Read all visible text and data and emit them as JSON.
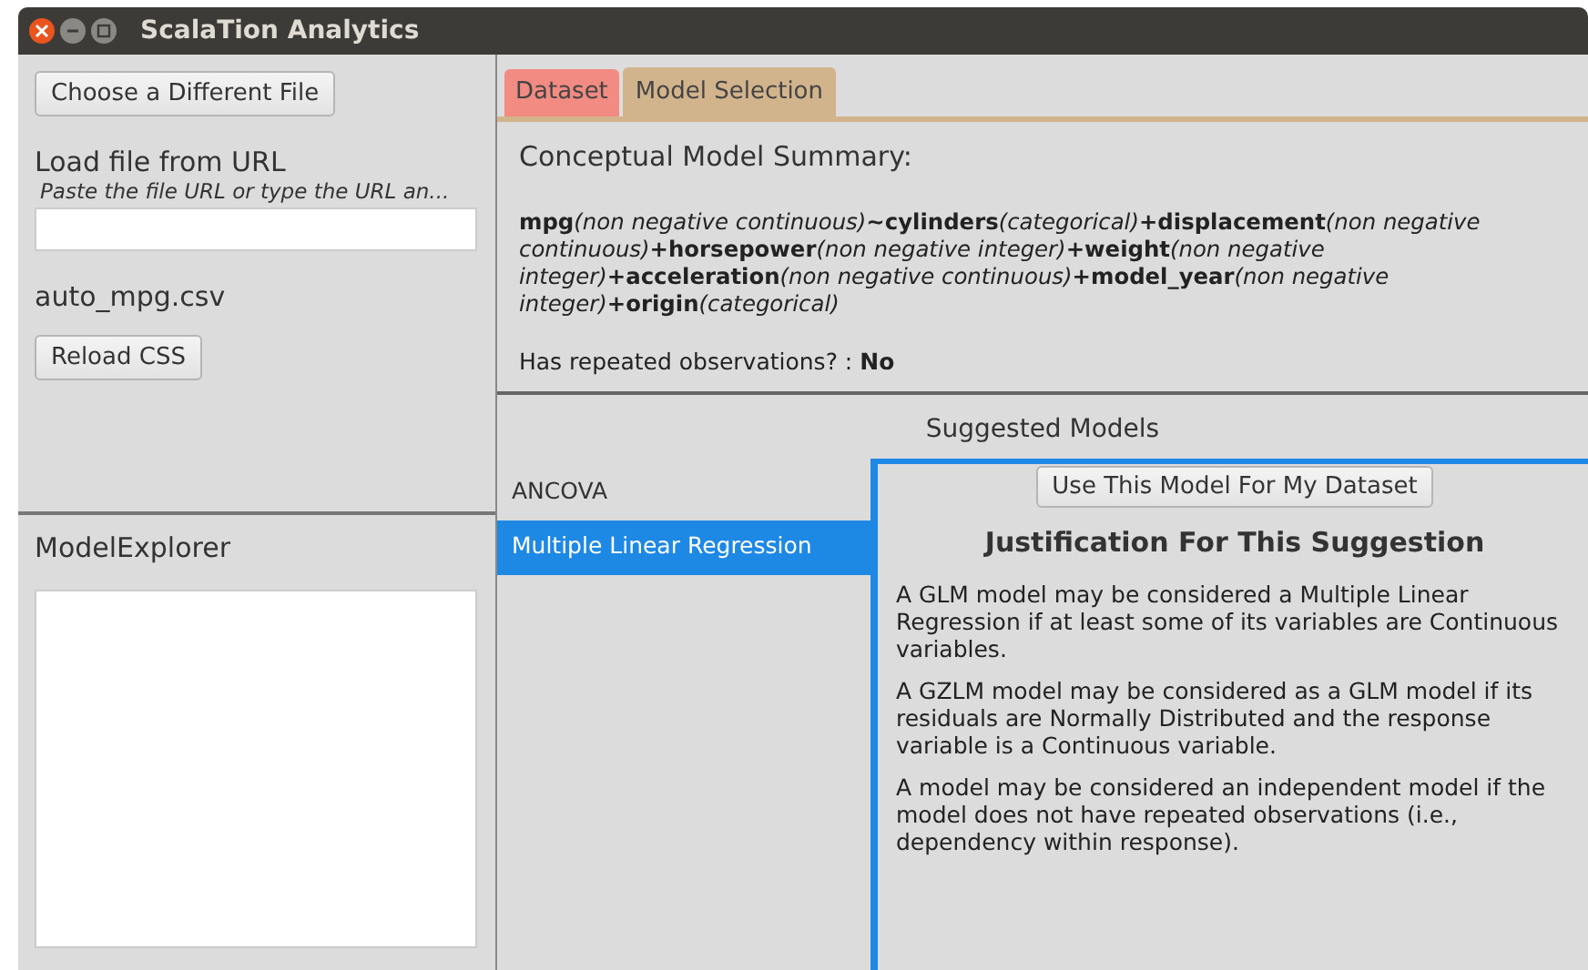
{
  "window": {
    "title": "ScalaTion Analytics"
  },
  "left_panel": {
    "choose_button": "Choose a Different File",
    "url_label": "Load file from URL",
    "url_placeholder": "Paste the file URL or type the URL an...",
    "file_name": "auto_mpg.csv",
    "reload_button": "Reload CSS"
  },
  "explorer": {
    "title": "ModelExplorer"
  },
  "tabs": [
    {
      "label": "Dataset",
      "selected": false,
      "color": "#f28b82"
    },
    {
      "label": "Model Selection",
      "selected": true,
      "color": "#d2b48c"
    }
  ],
  "summary": {
    "title": "Conceptual Model Summary:",
    "terms": [
      {
        "variable": "mpg",
        "type": "(non negative continuous)"
      },
      {
        "operator": "~",
        "variable": "cylinders",
        "type": "(categorical)"
      },
      {
        "operator": "+",
        "variable": "displacement",
        "type": "(non negative continuous)"
      },
      {
        "operator": "+",
        "variable": "horsepower",
        "type": "(non negative integer)"
      },
      {
        "operator": "+",
        "variable": "weight",
        "type": "(non negative integer)"
      },
      {
        "operator": "+",
        "variable": "acceleration",
        "type": "(non negative continuous)"
      },
      {
        "operator": "+",
        "variable": "model_year",
        "type": "(non negative integer)"
      },
      {
        "operator": "+",
        "variable": "origin",
        "type": "(categorical)"
      }
    ],
    "repeated_label": "Has repeated observations? :",
    "repeated_value": "No"
  },
  "suggested": {
    "title": "Suggested Models",
    "models": [
      {
        "label": "ANCOVA",
        "selected": false
      },
      {
        "label": "Multiple Linear Regression",
        "selected": true
      }
    ],
    "use_button": "Use This Model For My Dataset",
    "justification_title": "Justification For This Suggestion",
    "paragraphs": [
      "A GLM model may be considered a Multiple Linear Regression if at least some of its variables are Continuous variables.",
      "A GZLM model may be considered as a GLM model if its residuals are Normally Distributed and the response variable is a Continuous variable.",
      "A model may be considered an independent model if the model does not have repeated observations (i.e., dependency within response)."
    ]
  }
}
